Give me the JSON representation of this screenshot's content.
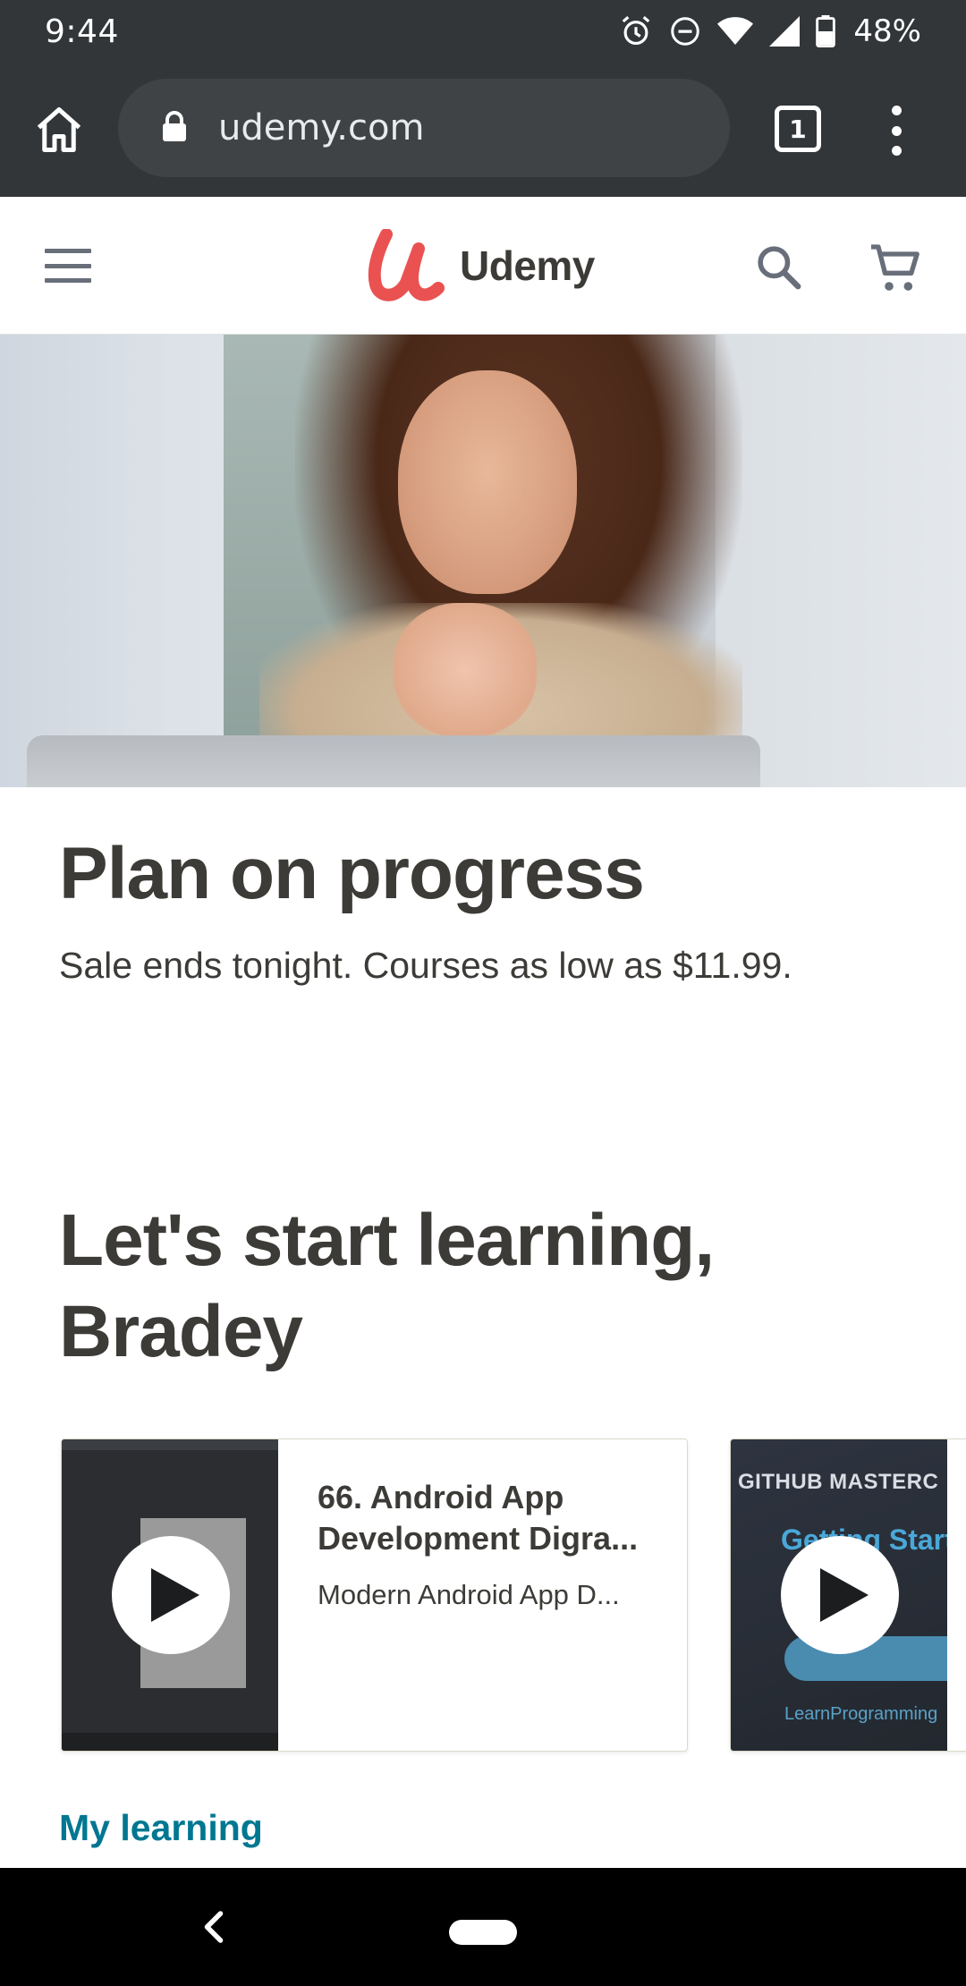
{
  "status_bar": {
    "time": "9:44",
    "battery": "48%",
    "icons": [
      "alarm-icon",
      "do-not-disturb-icon",
      "wifi-icon",
      "signal-icon",
      "battery-icon"
    ]
  },
  "browser": {
    "url": "udemy.com",
    "tab_count": "1",
    "icons": [
      "home-icon",
      "lock-icon",
      "tabs-icon",
      "overflow-menu-icon"
    ]
  },
  "header": {
    "logo_text": "Udemy",
    "brand_color": "#ea5252",
    "icons": [
      "hamburger-menu-icon",
      "search-icon",
      "cart-icon"
    ]
  },
  "promo": {
    "title": "Plan on progress",
    "subtitle": "Sale ends tonight. Courses as low as $11.99."
  },
  "greeting": "Let's start learning, Bradey",
  "courses": [
    {
      "title": "66. Android App Development Digra...",
      "subtitle": "Modern Android App D..."
    },
    {
      "thumbnail_text": "GITHUB MASTERC",
      "thumbnail_heading": "Getting Start",
      "thumbnail_logo": "LearnProgramming"
    }
  ],
  "section_link": {
    "label": "My learning",
    "color": "#007791"
  }
}
